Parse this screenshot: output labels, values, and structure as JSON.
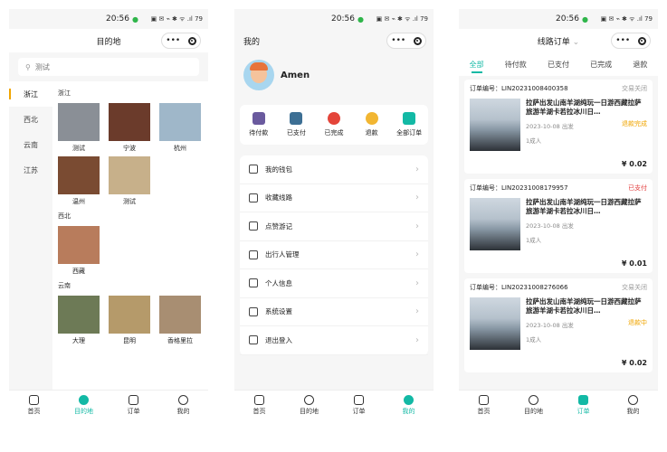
{
  "status": {
    "time": "20:56",
    "icons": "▣ ✉ ⌁ ✱ ᯤ .ıl 79"
  },
  "screen1": {
    "nav_title": "目的地",
    "search_placeholder": "测试",
    "sidebar": [
      {
        "label": "浙江",
        "active": true
      },
      {
        "label": "西北",
        "active": false
      },
      {
        "label": "云南",
        "active": false
      },
      {
        "label": "江苏",
        "active": false
      }
    ],
    "groups": [
      {
        "title": "浙江",
        "cities": [
          {
            "name": "测试",
            "color": "#8a8f96"
          },
          {
            "name": "宁波",
            "color": "#6b3b2b"
          },
          {
            "name": "杭州",
            "color": "#9fb7c9"
          },
          {
            "name": "温州",
            "color": "#7a4b32"
          },
          {
            "name": "测试",
            "color": "#c7b08a"
          }
        ]
      },
      {
        "title": "西北",
        "cities": [
          {
            "name": "西藏",
            "color": "#b87c5c"
          }
        ]
      },
      {
        "title": "云南",
        "cities": [
          {
            "name": "大理",
            "color": "#6d7a56"
          },
          {
            "name": "昆明",
            "color": "#b59a6a"
          },
          {
            "name": "香格里拉",
            "color": "#a88e72"
          }
        ]
      }
    ],
    "tabs": [
      {
        "label": "首页",
        "active": false
      },
      {
        "label": "目的地",
        "active": true
      },
      {
        "label": "订单",
        "active": false
      },
      {
        "label": "我的",
        "active": false
      }
    ]
  },
  "screen2": {
    "nav_title": "我的",
    "username": "Amen",
    "order_items": [
      {
        "label": "待付款",
        "color": "#6a5a9e"
      },
      {
        "label": "已支付",
        "color": "#3d6f94"
      },
      {
        "label": "已完成",
        "color": "#e4453a"
      },
      {
        "label": "退款",
        "color": "#f2b632"
      },
      {
        "label": "全部订单",
        "color": "#13b9a5"
      }
    ],
    "menu": [
      "我的钱包",
      "收藏线路",
      "点赞游记",
      "出行人管理",
      "个人信息",
      "系统设置",
      "退出登入"
    ],
    "tabs": [
      {
        "label": "首页",
        "active": false
      },
      {
        "label": "目的地",
        "active": false
      },
      {
        "label": "订单",
        "active": false
      },
      {
        "label": "我的",
        "active": true
      }
    ]
  },
  "screen3": {
    "nav_title": "线路订单",
    "order_tabs": [
      {
        "label": "全部",
        "active": true
      },
      {
        "label": "待付款",
        "active": false
      },
      {
        "label": "已支付",
        "active": false
      },
      {
        "label": "已完成",
        "active": false
      },
      {
        "label": "退款",
        "active": false
      }
    ],
    "orders": [
      {
        "no": "订单编号：LIN20231008400358",
        "status": "交易关闭",
        "status_color": "#999999",
        "title": "拉萨出发山南羊湖纯玩一日游西藏拉萨旅游羊湖卡若拉冰川日…",
        "date": "2023-10-08 出发",
        "people": "1成人",
        "state": "退款完成",
        "price": "¥ 0.02"
      },
      {
        "no": "订单编号：LIN20231008179957",
        "status": "已支付",
        "status_color": "#e34040",
        "title": "拉萨出发山南羊湖纯玩一日游西藏拉萨旅游羊湖卡若拉冰川日…",
        "date": "2023-10-08 出发",
        "people": "1成人",
        "state": "",
        "price": "¥ 0.01"
      },
      {
        "no": "订单编号：LIN20231008276066",
        "status": "交易关闭",
        "status_color": "#999999",
        "title": "拉萨出发山南羊湖纯玩一日游西藏拉萨旅游羊湖卡若拉冰川日…",
        "date": "2023-10-08 出发",
        "people": "1成人",
        "state": "退款中",
        "price": "¥ 0.02"
      }
    ],
    "tabs": [
      {
        "label": "首页",
        "active": false
      },
      {
        "label": "目的地",
        "active": false
      },
      {
        "label": "订单",
        "active": true
      },
      {
        "label": "我的",
        "active": false
      }
    ]
  }
}
